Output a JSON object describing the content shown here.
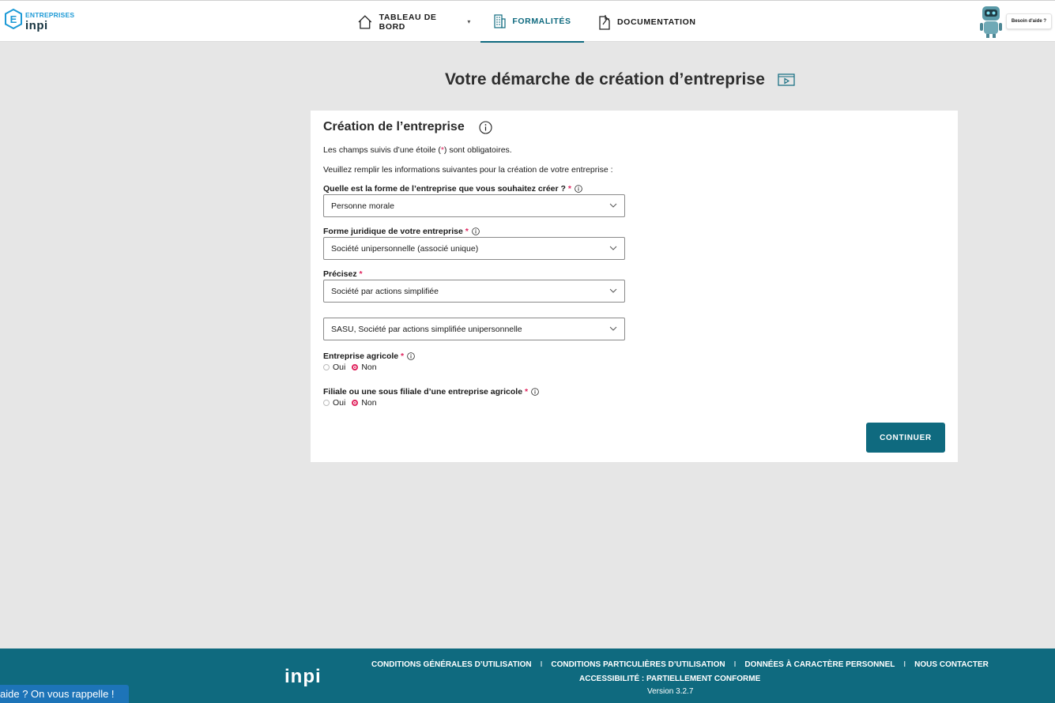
{
  "header": {
    "logo_line1": "ENTREPRISES",
    "logo_line2": "inpi",
    "nav": [
      {
        "label": "TABLEAU DE BORD",
        "icon": "home-icon",
        "has_caret": true
      },
      {
        "label": "FORMALITÉS",
        "icon": "building-icon",
        "active": true
      },
      {
        "label": "DOCUMENTATION",
        "icon": "document-icon"
      }
    ],
    "help_label": "Besoin d'aide ?"
  },
  "page": {
    "title": "Votre démarche de création d’entreprise"
  },
  "form": {
    "title": "Création de l’entreprise",
    "required_note_prefix": "Les champs suivis d’une étoile (",
    "required_star": "*",
    "required_note_suffix": ") sont obligatoires.",
    "intro": "Veuillez remplir les informations suivantes pour la création de votre entreprise :",
    "q_forme": "Quelle est la forme de l’entreprise que vous souhaitez créer ?",
    "v_forme": "Personne morale",
    "q_juridique": "Forme juridique de votre entreprise",
    "v_juridique": "Société unipersonnelle (associé unique)",
    "q_precisez": "Précisez",
    "v_precisez": "Société par actions simplifiée",
    "v_sub": "SASU, Société par actions simplifiée unipersonnelle",
    "q_agricole": "Entreprise agricole",
    "q_filiale": "Filiale ou une sous filiale d’une entreprise agricole",
    "star": "*",
    "opt_oui": "Oui",
    "opt_non": "Non",
    "agricole_selected": "Non",
    "filiale_selected": "Non",
    "continue_label": "CONTINUER"
  },
  "footer": {
    "logo": "inpi",
    "links": [
      "CONDITIONS GÉNÉRALES D’UTILISATION",
      "CONDITIONS PARTICULIÈRES D’UTILISATION",
      "DONNÉES À CARACTÈRE PERSONNEL",
      "NOUS CONTACTER"
    ],
    "separator": "I",
    "accessibility": "ACCESSIBILITÉ : PARTIELLEMENT CONFORME",
    "version": "Version 3.2.7"
  },
  "callback_label": "aide ? On vous rappelle !",
  "colors": {
    "accent": "#0f6a7f",
    "required": "#e0245e",
    "background": "#e6e6e6"
  }
}
